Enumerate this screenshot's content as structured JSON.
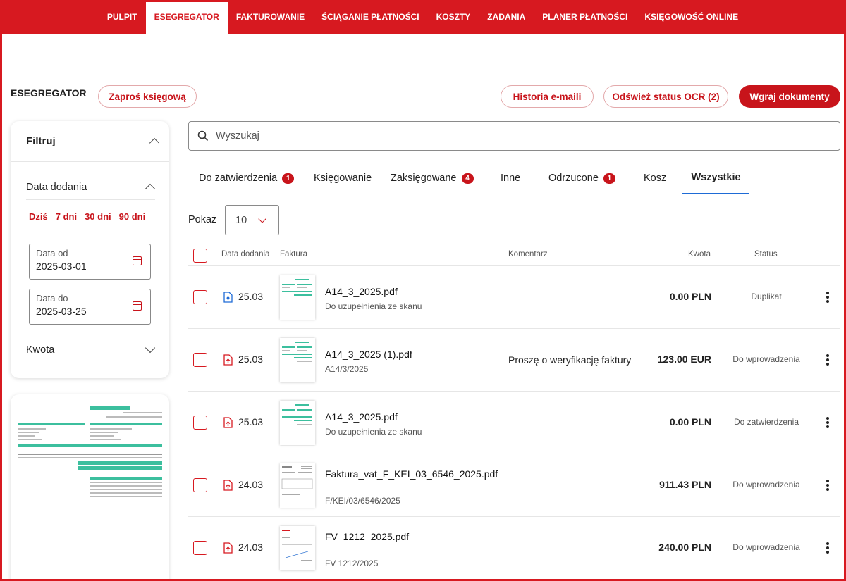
{
  "nav": {
    "items": [
      {
        "label": "PULPIT"
      },
      {
        "label": "ESEGREGATOR"
      },
      {
        "label": "FAKTUROWANIE"
      },
      {
        "label": "ŚCIĄGANIE PŁATNOŚCI"
      },
      {
        "label": "KOSZTY"
      },
      {
        "label": "ZADANIA"
      },
      {
        "label": "PLANER PŁATNOŚCI"
      },
      {
        "label": "KSIĘGOWOŚĆ ONLINE"
      }
    ],
    "active_index": 1
  },
  "header": {
    "title": "ESEGREGATOR",
    "invite_label": "Zaproś księgową",
    "email_history_label": "Historia e-maili",
    "refresh_ocr_label": "Odśwież status OCR (2)",
    "upload_label": "Wgraj dokumenty"
  },
  "filters": {
    "title": "Filtruj",
    "date_section": "Data dodania",
    "quick_ranges": [
      "Dziś",
      "7 dni",
      "30 dni",
      "90 dni"
    ],
    "date_from": {
      "label": "Data od",
      "value": "2025-03-01"
    },
    "date_to": {
      "label": "Data do",
      "value": "2025-03-25"
    },
    "amount_section": "Kwota"
  },
  "search": {
    "placeholder": "Wyszukaj"
  },
  "tabs": [
    {
      "label": "Do zatwierdzenia",
      "badge": "1"
    },
    {
      "label": "Księgowanie",
      "badge": ""
    },
    {
      "label": "Zaksięgowane",
      "badge": "4"
    },
    {
      "label": "Inne",
      "badge": ""
    },
    {
      "label": "Odrzucone",
      "badge": "1"
    },
    {
      "label": "Kosz",
      "badge": ""
    },
    {
      "label": "Wszystkie",
      "badge": ""
    }
  ],
  "active_tab": "Wszystkie",
  "page_size": {
    "label": "Pokaż",
    "value": "10"
  },
  "table": {
    "columns": [
      "Data dodania",
      "Faktura",
      "Komentarz",
      "Kwota",
      "Status"
    ],
    "rows": [
      {
        "date": "25.03",
        "file": "A14_3_2025.pdf",
        "sub": "Do uzupełnienia ze skanu",
        "comment": "",
        "amount": "0.00 PLN",
        "status": "Duplikat",
        "icon": "document-blue-icon"
      },
      {
        "date": "25.03",
        "file": "A14_3_2025 (1).pdf",
        "sub": "A14/3/2025",
        "comment": "Proszę o weryfikację faktury",
        "amount": "123.00 EUR",
        "status": "Do wprowadzenia",
        "icon": "pdf-upload-icon"
      },
      {
        "date": "25.03",
        "file": "A14_3_2025.pdf",
        "sub": "Do uzupełnienia ze skanu",
        "comment": "",
        "amount": "0.00 PLN",
        "status": "Do zatwierdzenia",
        "icon": "pdf-upload-icon"
      },
      {
        "date": "24.03",
        "file": "Faktura_vat_F_KEI_03_6546_2025.pdf",
        "sub": "F/KEI/03/6546/2025",
        "comment": "",
        "amount": "911.43 PLN",
        "status": "Do wprowadzenia",
        "icon": "pdf-upload-icon"
      },
      {
        "date": "24.03",
        "file": "FV_1212_2025.pdf",
        "sub": "FV 1212/2025",
        "comment": "",
        "amount": "240.00 PLN",
        "status": "Do wprowadzenia",
        "icon": "pdf-upload-icon"
      }
    ]
  },
  "colors": {
    "brand": "#d71920",
    "accent": "#c8141b",
    "tab_underline": "#1e6bd6",
    "thumb_table": "#3cbf9e"
  }
}
